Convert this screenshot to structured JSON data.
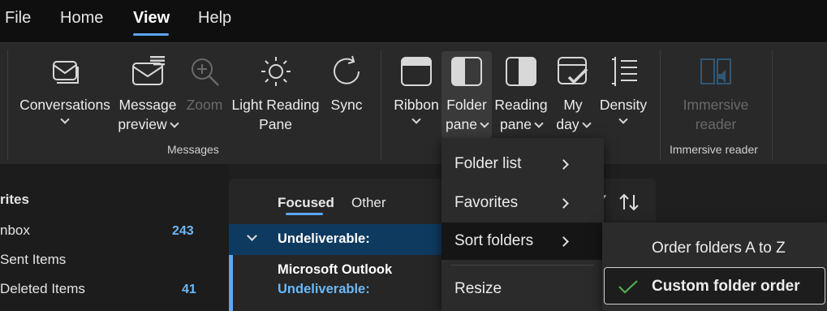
{
  "menubar": {
    "tabs": [
      {
        "label": "File"
      },
      {
        "label": "Home"
      },
      {
        "label": "View"
      },
      {
        "label": "Help"
      }
    ],
    "active": "View"
  },
  "ribbon": {
    "messages_group": {
      "label": "Messages",
      "conversations": {
        "line1": "Conversations"
      },
      "message_preview": {
        "line1": "Message",
        "line2": "preview"
      },
      "zoom": {
        "line1": "Zoom"
      },
      "light_reading_pane": {
        "line1": "Light Reading",
        "line2": "Pane"
      },
      "sync": {
        "line1": "Sync"
      }
    },
    "layout_group": {
      "ribbon": {
        "line1": "Ribbon"
      },
      "folder_pane": {
        "line1": "Folder",
        "line2": "pane"
      },
      "reading_pane": {
        "line1": "Reading",
        "line2": "pane"
      },
      "my_day": {
        "line1": "My",
        "line2": "day"
      },
      "density": {
        "line1": "Density"
      }
    },
    "immersive_group": {
      "label": "Immersive reader",
      "immersive_reader": {
        "line1": "Immersive",
        "line2": "reader"
      }
    }
  },
  "sidebar": {
    "header": "rites",
    "items": [
      {
        "label": "nbox",
        "count": "243"
      },
      {
        "label": "Sent Items",
        "count": ""
      },
      {
        "label": "Deleted Items",
        "count": "41"
      }
    ]
  },
  "maillist": {
    "tab_focused": "Focused",
    "tab_other": "Other",
    "group_label": "Undeliverable:",
    "message": {
      "sender": "Microsoft Outlook",
      "subject": "Undeliverable:"
    }
  },
  "dropdown": {
    "items": [
      {
        "label": "Folder list",
        "has_submenu": true
      },
      {
        "label": "Favorites",
        "has_submenu": true
      },
      {
        "label": "Sort folders",
        "has_submenu": true
      },
      {
        "label": "Resize",
        "has_submenu": false
      }
    ],
    "highlighted": "Sort folders"
  },
  "submenu": {
    "items": [
      {
        "label": "Order folders A to Z",
        "checked": false
      },
      {
        "label": "Custom folder order",
        "checked": true
      }
    ]
  },
  "colors": {
    "accent": "#5aa7f3",
    "menubar_bg": "#0f0f0f",
    "ribbon_bg": "#292929",
    "selected_row": "#0f3a5f",
    "check": "#4fb04f"
  }
}
